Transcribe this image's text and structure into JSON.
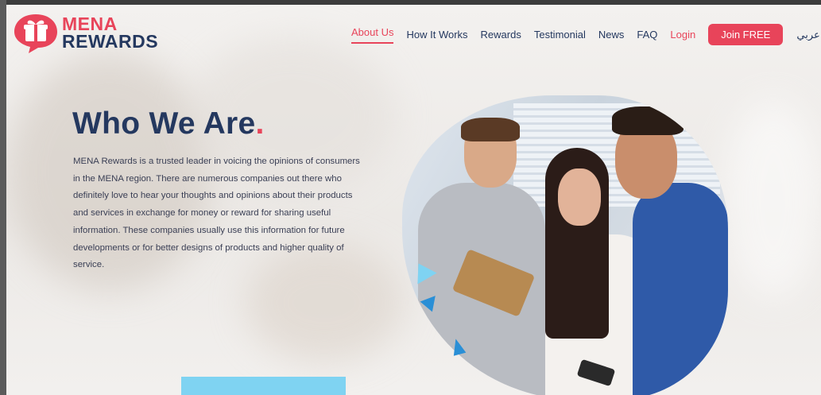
{
  "brand": {
    "line1": "MENA",
    "line2": "REWARDS",
    "primary": "#e8445a",
    "navy": "#24385f"
  },
  "nav": {
    "items": [
      {
        "label": "About Us",
        "active": true
      },
      {
        "label": "How It Works"
      },
      {
        "label": "Rewards"
      },
      {
        "label": "Testimonial"
      },
      {
        "label": "News"
      },
      {
        "label": "FAQ"
      },
      {
        "label": "Login"
      }
    ],
    "join_label": "Join FREE",
    "language": "عربي"
  },
  "hero": {
    "title": "Who We Are",
    "title_dot": ".",
    "body": "MENA Rewards is a trusted leader in voicing the opinions of consumers in the MENA region. There are numerous companies out there who definitely love to hear your thoughts and opinions about their products and services in exchange for money or reward for sharing useful information. These companies usually use this information for future developments or for better designs of products and higher quality of service."
  },
  "accent": {
    "cyan": "#7fd3f2"
  }
}
